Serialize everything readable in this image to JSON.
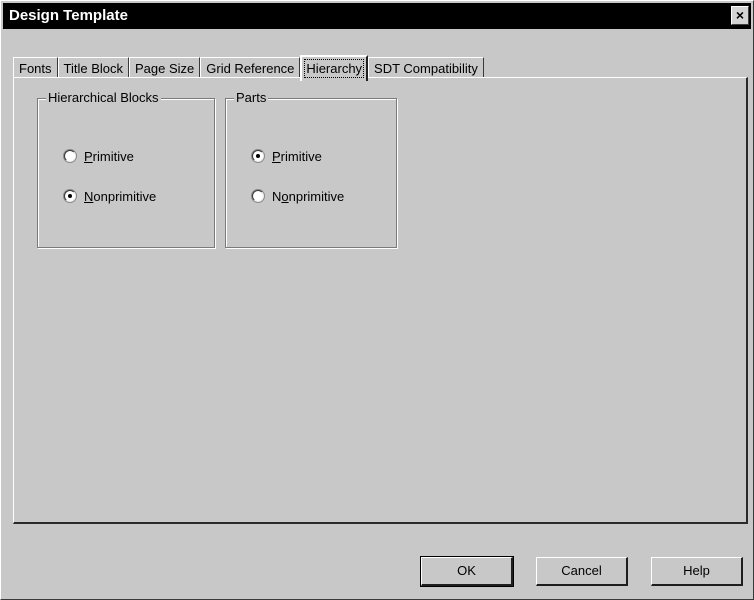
{
  "window": {
    "title": "Design Template",
    "close_glyph": "×"
  },
  "tabs": [
    {
      "label": "Fonts",
      "active": false
    },
    {
      "label": "Title Block",
      "active": false
    },
    {
      "label": "Page Size",
      "active": false
    },
    {
      "label": "Grid Reference",
      "active": false
    },
    {
      "label": "Hierarchy",
      "active": true
    },
    {
      "label": "SDT Compatibility",
      "active": false
    }
  ],
  "groups": {
    "hierarchical_blocks": {
      "legend": "Hierarchical Blocks",
      "options": [
        {
          "label_mn": "P",
          "label_rest": "rimitive",
          "checked": false
        },
        {
          "label_mn": "N",
          "label_rest": "onprimitive",
          "checked": true
        }
      ]
    },
    "parts": {
      "legend": "Parts",
      "options": [
        {
          "label_pre": "",
          "label_mn": "P",
          "label_rest": "rimitive",
          "checked": true
        },
        {
          "label_pre": "N",
          "label_mn": "o",
          "label_rest": "nprimitive",
          "checked": false
        }
      ]
    }
  },
  "buttons": {
    "ok": "OK",
    "cancel": "Cancel",
    "help": "Help"
  }
}
